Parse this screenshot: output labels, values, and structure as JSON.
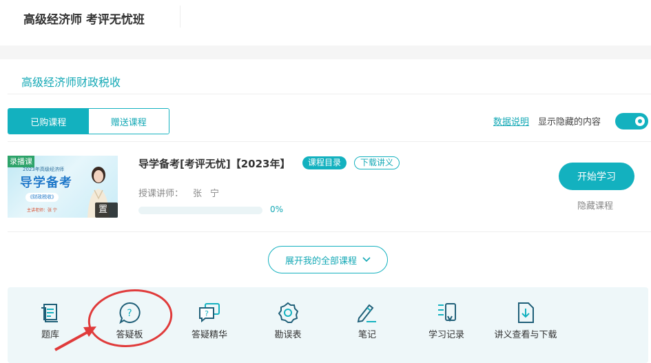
{
  "header": {
    "title": "高级经济师 考评无忧班"
  },
  "main": {
    "course_title": "高级经济师财政税收",
    "tabs": [
      {
        "label": "已购课程",
        "active": true
      },
      {
        "label": "赠送课程",
        "active": false
      }
    ],
    "data_link": "数据说明",
    "show_hidden_label": "显示隐藏的内容",
    "show_hidden_on": true
  },
  "course": {
    "thumb": {
      "tag": "录播课",
      "subtitle": "2023年高级经济师",
      "headline": "导学备考",
      "pill": "《财政税收》",
      "lector": "主讲老师：张 宁",
      "pin": "置顶"
    },
    "title": "导学备考[考评无忧]【2023年】",
    "badge_catalog": "课程目录",
    "badge_download": "下载讲义",
    "teacher_label": "授课讲师：",
    "teacher_name": "张宁",
    "progress": 0,
    "progress_text": "0%",
    "start_button": "开始学习",
    "hide_course": "隐藏课程"
  },
  "expand_button": "展开我的全部课程",
  "tools": [
    {
      "label": "题库",
      "icon": "question-bank-icon"
    },
    {
      "label": "答疑板",
      "icon": "qa-board-icon"
    },
    {
      "label": "答疑精华",
      "icon": "qa-highlights-icon"
    },
    {
      "label": "勘误表",
      "icon": "errata-icon"
    },
    {
      "label": "笔记",
      "icon": "notes-icon"
    },
    {
      "label": "学习记录",
      "icon": "study-record-icon"
    },
    {
      "label": "讲义查看与下载",
      "icon": "handout-download-icon"
    }
  ],
  "colors": {
    "accent": "#13b1bf",
    "annotation": "#e03b3b"
  }
}
